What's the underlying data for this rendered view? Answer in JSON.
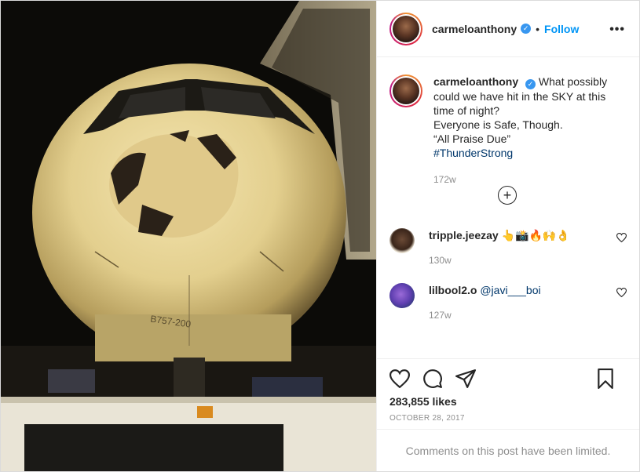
{
  "post": {
    "author": "carmeloanthony",
    "verified_mark": "✓",
    "separator": "•",
    "follow_label": "Follow",
    "more_label": "•••",
    "image_alt": "Damaged nose of a B757-200 aircraft at night",
    "image_text": "B757-200",
    "caption": {
      "line1": "What possibly could we have hit in the SKY at this time of night?",
      "line2": "Everyone is Safe, Though.",
      "line3": "“All Praise Due”",
      "hashtag": "#ThunderStrong"
    },
    "caption_time": "172w",
    "load_more_icon": "plus-circle-icon",
    "comments": [
      {
        "user": "tripple.jeezay",
        "text": "👆📸🔥🙌👌",
        "time": "130w"
      },
      {
        "user": "lilbool2.o",
        "text": "@javi___boi",
        "time": "127w"
      }
    ],
    "likes": "283,855 likes",
    "date": "OCTOBER 28, 2017",
    "comments_limited": "Comments on this post have been limited."
  },
  "colors": {
    "accent": "#0095f6",
    "verified": "#3897f0",
    "hashtag": "#00376b",
    "muted": "#8e8e8e"
  }
}
